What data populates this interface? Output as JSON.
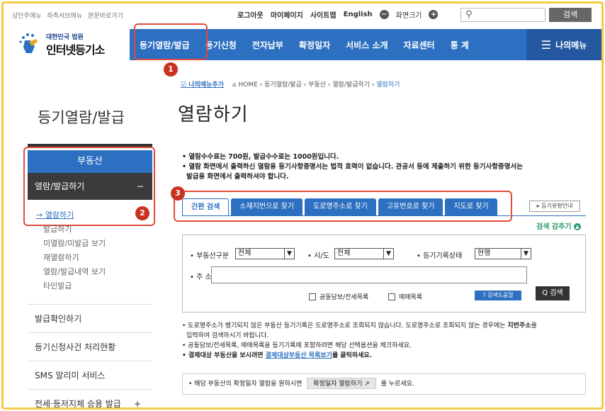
{
  "util": {
    "left_links": [
      "상단주메뉴",
      "좌측서브메뉴",
      "본문바로가기"
    ],
    "logout": "로그아웃",
    "mypage": "마이페이지",
    "sitemap": "사이트맵",
    "english": "English",
    "zoom_minus": "−",
    "zoom_label": "화면크기",
    "zoom_plus": "+",
    "search_button": "검색"
  },
  "logo": {
    "small": "대한민국 법원",
    "big": "인터넷등기소"
  },
  "gnb": {
    "items": [
      "등기열람/발급",
      "등기신청",
      "전자납부",
      "확정일자",
      "서비스 소개",
      "자료센터",
      "통 계"
    ],
    "my_menu": "나의메뉴"
  },
  "badges": [
    "1",
    "2",
    "3"
  ],
  "breadcrumb": {
    "my_menu_add": "나의메뉴추가",
    "items": [
      "HOME",
      "등기열람/발급",
      "부동산",
      "열람/발급하기"
    ],
    "current": "열람하기"
  },
  "side": {
    "title": "등기열람/발급",
    "head": "부동산",
    "selected": "열람/발급하기",
    "selected_toggle": "−",
    "sub_items": [
      "열람하기",
      "발급하기",
      "미열람/미발급 보기",
      "재열람하기",
      "열람/발급내역 보기",
      "타인발급"
    ],
    "rows": [
      "발급확인하기",
      "등기신청사건 처리현황",
      "SMS 알리미 서비스",
      "전세·등저지체 승용 발급"
    ],
    "last_toggle": "+"
  },
  "main": {
    "title": "열람하기",
    "notes": [
      "• 열람수수료는 700원, 발급수수료는 1000원입니다.",
      "• 열람 화면에서 출력하신 열람용 등기사항증명서는 법적 효력이 없습니다. 관공서 등에 제출하기 위한 등기사항증명서는",
      "발급용 화면에서 출력하셔야 합니다."
    ],
    "tabs": [
      "간편 검색",
      "소재지번으로 찾기",
      "도로명주소로 찾기",
      "고유번호로 찾기",
      "지도로 찾기"
    ],
    "guide_button": "▸ 등기유형안내",
    "fold_label": "검색 감추기",
    "fold_icon": "▲"
  },
  "search": {
    "type_label": "• 부동산구분",
    "type_value": "전체",
    "sido_label": "• 시/도",
    "sido_value": "전체",
    "status_label": "• 등기기록상태",
    "status_value": "현행",
    "address_label": "• 주 소",
    "address_value": "",
    "check1": "공동담보/전세목록",
    "check2": "매매목록",
    "help_button": "? 검색도움말",
    "search_button": "Q 검색"
  },
  "bottom": {
    "line1": "• 도로명주소가 병기되지 않은 부동산 등기기록은 도로명주소로 조회되지 않습니다. 도로명주소로 조회되지 않는 경우에는",
    "line1_bold": "지번주소",
    "line1_end": "를",
    "line2": "입력하여 검색하시기 바랍니다.",
    "line3": "• 공동담보/전세목록, 매매목록을 등기기록에 포함하려면 해당 선택옵션을 체크하세요.",
    "line4_a": "• 결제대상 부동산을 보시려면",
    "line4_link": "결제대상부동산 목록보기",
    "line4_b": "를 클릭하세요.",
    "box_a": "• 해당 부동산의 확정일자 열람을 원하시면",
    "box_btn": "확정일자 열람하기 ↗",
    "box_b": "를 누르세요."
  }
}
